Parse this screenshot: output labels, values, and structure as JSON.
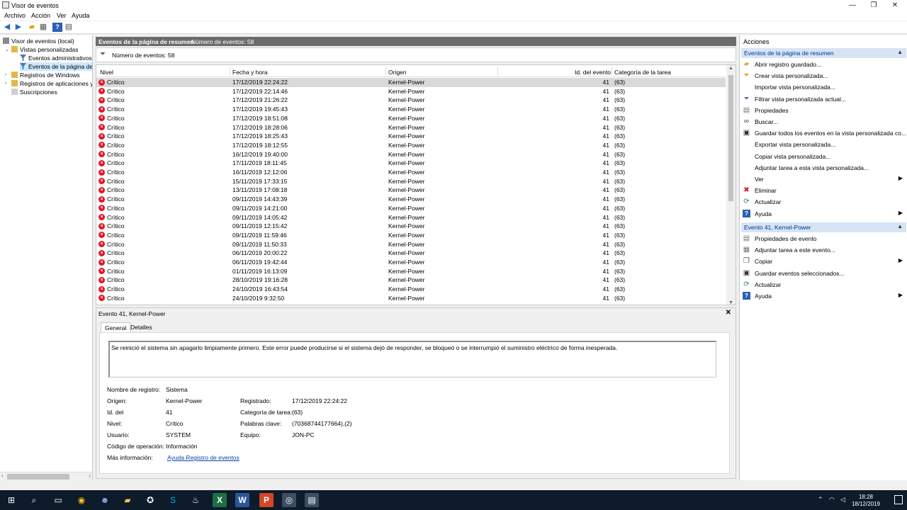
{
  "window": {
    "title": "Visor de eventos",
    "controls": {
      "minimize": "—",
      "maximize": "❐",
      "close": "✕"
    }
  },
  "menu": [
    "Archivo",
    "Acción",
    "Ver",
    "Ayuda"
  ],
  "tree": {
    "items": [
      {
        "label": "Visor de eventos (local)",
        "level": 0
      },
      {
        "label": "Vistas personalizadas",
        "level": 1,
        "expanded": true
      },
      {
        "label": "Eventos administrativos",
        "level": 2
      },
      {
        "label": "Eventos de la página de r",
        "level": 2,
        "selected": true
      },
      {
        "label": "Registros de Windows",
        "level": 1
      },
      {
        "label": "Registros de aplicaciones y s",
        "level": 1
      },
      {
        "label": "Suscripciones",
        "level": 1
      }
    ]
  },
  "center": {
    "header_title": "Eventos de la página de resumen",
    "header_count": "Número de eventos: 58",
    "filter_text": "Número de eventos: 58",
    "columns": [
      "Nivel",
      "Fecha y hora",
      "Origen",
      "Id. del evento",
      "Categoría de la tarea"
    ],
    "rows": [
      [
        "Crítico",
        "17/12/2019 22:24:22",
        "Kernel-Power",
        "41",
        "(63)"
      ],
      [
        "Crítico",
        "17/12/2019 22:14:46",
        "Kernel-Power",
        "41",
        "(63)"
      ],
      [
        "Crítico",
        "17/12/2019 21:26:22",
        "Kernel-Power",
        "41",
        "(63)"
      ],
      [
        "Crítico",
        "17/12/2019 19:45:43",
        "Kernel-Power",
        "41",
        "(63)"
      ],
      [
        "Crítico",
        "17/12/2019 18:51:08",
        "Kernel-Power",
        "41",
        "(63)"
      ],
      [
        "Crítico",
        "17/12/2019 18:28:06",
        "Kernel-Power",
        "41",
        "(63)"
      ],
      [
        "Crítico",
        "17/12/2019 18:25:43",
        "Kernel-Power",
        "41",
        "(63)"
      ],
      [
        "Crítico",
        "17/12/2019 18:12:55",
        "Kernel-Power",
        "41",
        "(63)"
      ],
      [
        "Crítico",
        "16/12/2019 19:40:00",
        "Kernel-Power",
        "41",
        "(63)"
      ],
      [
        "Crítico",
        "17/11/2019 18:11:45",
        "Kernel-Power",
        "41",
        "(63)"
      ],
      [
        "Crítico",
        "16/11/2019 12:12:06",
        "Kernel-Power",
        "41",
        "(63)"
      ],
      [
        "Crítico",
        "15/11/2019 17:33:15",
        "Kernel-Power",
        "41",
        "(63)"
      ],
      [
        "Crítico",
        "13/11/2019 17:08:18",
        "Kernel-Power",
        "41",
        "(63)"
      ],
      [
        "Crítico",
        "09/11/2019 14:43:39",
        "Kernel-Power",
        "41",
        "(63)"
      ],
      [
        "Crítico",
        "09/11/2019 14:21:00",
        "Kernel-Power",
        "41",
        "(63)"
      ],
      [
        "Crítico",
        "09/11/2019 14:05:42",
        "Kernel-Power",
        "41",
        "(63)"
      ],
      [
        "Crítico",
        "09/11/2019 12:15:42",
        "Kernel-Power",
        "41",
        "(63)"
      ],
      [
        "Crítico",
        "09/11/2019 11:59:46",
        "Kernel-Power",
        "41",
        "(63)"
      ],
      [
        "Crítico",
        "09/11/2019 11:50:33",
        "Kernel-Power",
        "41",
        "(63)"
      ],
      [
        "Crítico",
        "06/11/2019 20:00:22",
        "Kernel-Power",
        "41",
        "(63)"
      ],
      [
        "Crítico",
        "06/11/2019 19:42:44",
        "Kernel-Power",
        "41",
        "(63)"
      ],
      [
        "Crítico",
        "01/11/2019 16:13:09",
        "Kernel-Power",
        "41",
        "(63)"
      ],
      [
        "Crítico",
        "28/10/2019 19:16:28",
        "Kernel-Power",
        "41",
        "(63)"
      ],
      [
        "Crítico",
        "24/10/2019 16:43:54",
        "Kernel-Power",
        "41",
        "(63)"
      ],
      [
        "Crítico",
        "24/10/2019 9:32:50",
        "Kernel-Power",
        "41",
        "(63)"
      ]
    ]
  },
  "detail": {
    "title": "Evento 41, Kernel-Power",
    "tabs": [
      "General",
      "Detalles"
    ],
    "description": "Se reinició el sistema sin apagarlo limpiamente primero. Este error puede producirse si el sistema dejó de responder, se bloqueó o se interrumpió el suministro eléctrico de forma inesperada.",
    "fields": {
      "log_name_label": "Nombre de registro:",
      "log_name": "Sistema",
      "source_label": "Origen:",
      "source": "Kernel-Power",
      "logged_label": "Registrado:",
      "logged": "17/12/2019 22:24:22",
      "event_id_label": "Id. del",
      "event_id": "41",
      "task_cat_label": "Categoría de tarea:",
      "task_cat": "(63)",
      "level_label": "Nivel:",
      "level": "Crítico",
      "keywords_label": "Palabras clave:",
      "keywords": "(70368744177664),(2)",
      "user_label": "Usuario:",
      "user": "SYSTEM",
      "computer_label": "Equipo:",
      "computer": "JON-PC",
      "opcode_label": "Código de operación:",
      "opcode": "Información",
      "more_info_label": "Más información:",
      "more_info_link": "Ayuda Registro de eventos"
    }
  },
  "actions": {
    "title": "Acciones",
    "section1": {
      "title": "Eventos de la página de resumen",
      "items": [
        {
          "label": "Abrir registro guardado...",
          "icon": "folder-open-icon"
        },
        {
          "label": "Crear vista personalizada...",
          "icon": "filter-new-icon"
        },
        {
          "label": "Importar vista personalizada...",
          "icon": ""
        },
        {
          "label": "Filtrar vista personalizada actual...",
          "icon": "filter-icon"
        },
        {
          "label": "Propiedades",
          "icon": "properties-icon"
        },
        {
          "label": "Buscar...",
          "icon": "binoculars-icon"
        },
        {
          "label": "Guardar todos los eventos en la vista personalizada co...",
          "icon": "save-icon"
        },
        {
          "label": "Exportar vista personalizada...",
          "icon": ""
        },
        {
          "label": "Copiar vista personalizada...",
          "icon": ""
        },
        {
          "label": "Adjuntar tarea a esta vista personalizada...",
          "icon": ""
        },
        {
          "label": "Ver",
          "icon": "",
          "submenu": true
        },
        {
          "label": "Eliminar",
          "icon": "delete-icon"
        },
        {
          "label": "Actualizar",
          "icon": "refresh-icon"
        },
        {
          "label": "Ayuda",
          "icon": "help-icon",
          "submenu": true
        }
      ]
    },
    "section2": {
      "title": "Evento 41, Kernel-Power",
      "items": [
        {
          "label": "Propiedades de evento",
          "icon": "properties-icon"
        },
        {
          "label": "Adjuntar tarea a este evento...",
          "icon": "task-icon"
        },
        {
          "label": "Copiar",
          "icon": "copy-icon",
          "submenu": true
        },
        {
          "label": "Guardar eventos seleccionados...",
          "icon": "save-icon"
        },
        {
          "label": "Actualizar",
          "icon": "refresh-icon"
        },
        {
          "label": "Ayuda",
          "icon": "help-icon",
          "submenu": true
        }
      ]
    }
  },
  "taskbar": {
    "time": "18:28",
    "date": "18/12/2019"
  },
  "colors": {
    "accent_header": "#6b6b6b",
    "section_head": "#d6e4f4",
    "error_red": "#e81123",
    "selection": "#cce8ff"
  }
}
